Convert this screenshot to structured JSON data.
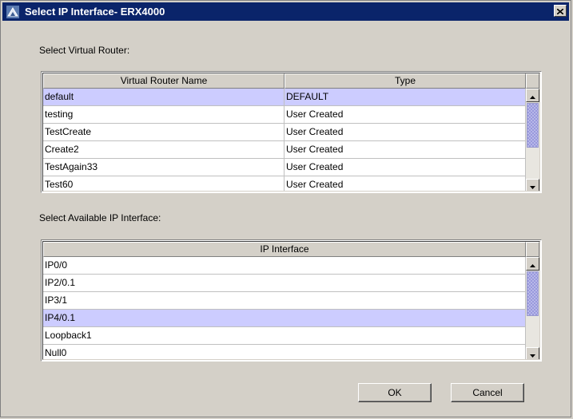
{
  "window": {
    "title": "Select IP Interface- ERX4000",
    "app_icon": "router-icon",
    "close_icon": "close-icon"
  },
  "virtual_router": {
    "label": "Select Virtual Router:",
    "columns": [
      "Virtual Router Name",
      "Type"
    ],
    "rows": [
      {
        "name": "default",
        "type": "DEFAULT",
        "selected": true
      },
      {
        "name": "testing",
        "type": "User Created",
        "selected": false
      },
      {
        "name": "TestCreate",
        "type": "User Created",
        "selected": false
      },
      {
        "name": "Create2",
        "type": "User Created",
        "selected": false
      },
      {
        "name": "TestAgain33",
        "type": "User Created",
        "selected": false
      },
      {
        "name": "Test60",
        "type": "User Created",
        "selected": false
      }
    ]
  },
  "ip_interface": {
    "label": "Select Available IP Interface:",
    "columns": [
      "IP Interface"
    ],
    "rows": [
      {
        "name": "IP0/0",
        "selected": false
      },
      {
        "name": "IP2/0.1",
        "selected": false
      },
      {
        "name": "IP3/1",
        "selected": false
      },
      {
        "name": "IP4/0.1",
        "selected": true
      },
      {
        "name": "Loopback1",
        "selected": false
      },
      {
        "name": "Null0",
        "selected": false
      }
    ]
  },
  "buttons": {
    "ok": "OK",
    "cancel": "Cancel"
  },
  "colors": {
    "title_bar": "#0a246a",
    "selection": "#ccccff",
    "dialog_bg": "#d4d0c8"
  }
}
